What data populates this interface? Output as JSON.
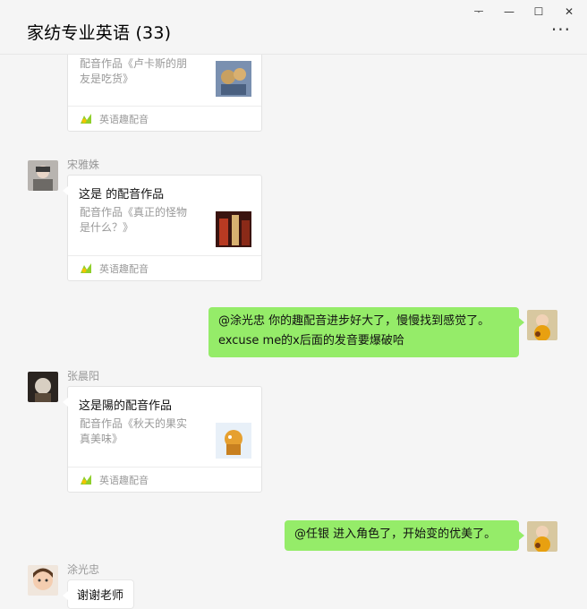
{
  "window": {
    "title": "家纺专业英语 (33)",
    "controls": {
      "pin": "ᅮ",
      "minimize": "—",
      "maximize": "☐",
      "close": "✕"
    },
    "more": "···"
  },
  "messages": {
    "card0": {
      "desc": "配音作品《卢卡斯的朋友是吃货》",
      "app": "英语趣配音",
      "thumb_icon": "video-thumbnail"
    },
    "card1": {
      "sender": "宋雅姝",
      "title": "这是 的配音作品",
      "desc": "配音作品《真正的怪物是什么？》",
      "app": "英语趣配音",
      "thumb_icon": "video-thumbnail"
    },
    "out1": {
      "text": "@涂光忠 你的趣配音进步好大了，慢慢找到感觉了。excuse me的x后面的发音要爆破哈"
    },
    "card2": {
      "sender": "张晨阳",
      "title": "这是陽的配音作品",
      "desc": "配音作品《秋天的果实真美味》",
      "app": "英语趣配音",
      "thumb_icon": "video-thumbnail"
    },
    "out2": {
      "text": "@任银 进入角色了，开始变的优美了。"
    },
    "in3": {
      "sender": "涂光忠",
      "text": "谢谢老师"
    }
  },
  "colors": {
    "bubble_green": "#95ec69",
    "background": "#f5f5f5"
  }
}
